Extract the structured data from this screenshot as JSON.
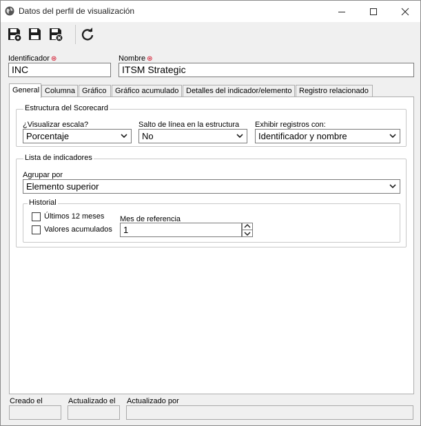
{
  "window": {
    "title": "Datos del perfil de visualización"
  },
  "toolbar": {
    "buttons": [
      "save-new-icon",
      "save-icon",
      "save-close-icon",
      "refresh-icon"
    ]
  },
  "header_fields": {
    "identifier_label": "Identificador",
    "identifier_value": "INC",
    "name_label": "Nombre",
    "name_value": "ITSM Strategic"
  },
  "tabs": [
    {
      "label": "General",
      "active": true
    },
    {
      "label": "Columna"
    },
    {
      "label": "Gráfico"
    },
    {
      "label": "Gráfico acumulado"
    },
    {
      "label": "Detalles del indicador/elemento"
    },
    {
      "label": "Registro relacionado"
    }
  ],
  "scorecard": {
    "title": "Estructura del Scorecard",
    "scale_label": "¿Visualizar escala?",
    "scale_value": "Porcentaje",
    "linebreak_label": "Salto de línea en la estructura",
    "linebreak_value": "No",
    "display_label": "Exhibir registros con:",
    "display_value": "Identificador y nombre"
  },
  "indicators": {
    "title": "Lista de indicadores",
    "group_label": "Agrupar por",
    "group_value": "Elemento superior",
    "history": {
      "title": "Historial",
      "last12_label": "Últimos 12 meses",
      "last12_checked": false,
      "accum_label": "Valores acumulados",
      "accum_checked": false,
      "ref_month_label": "Mes de referencia",
      "ref_month_value": "1"
    }
  },
  "footer": {
    "created_label": "Creado el",
    "updated_label": "Actualizado el",
    "updated_by_label": "Actualizado por"
  },
  "colors": {
    "required": "#d0021b",
    "icon": "#1f1f1f"
  }
}
